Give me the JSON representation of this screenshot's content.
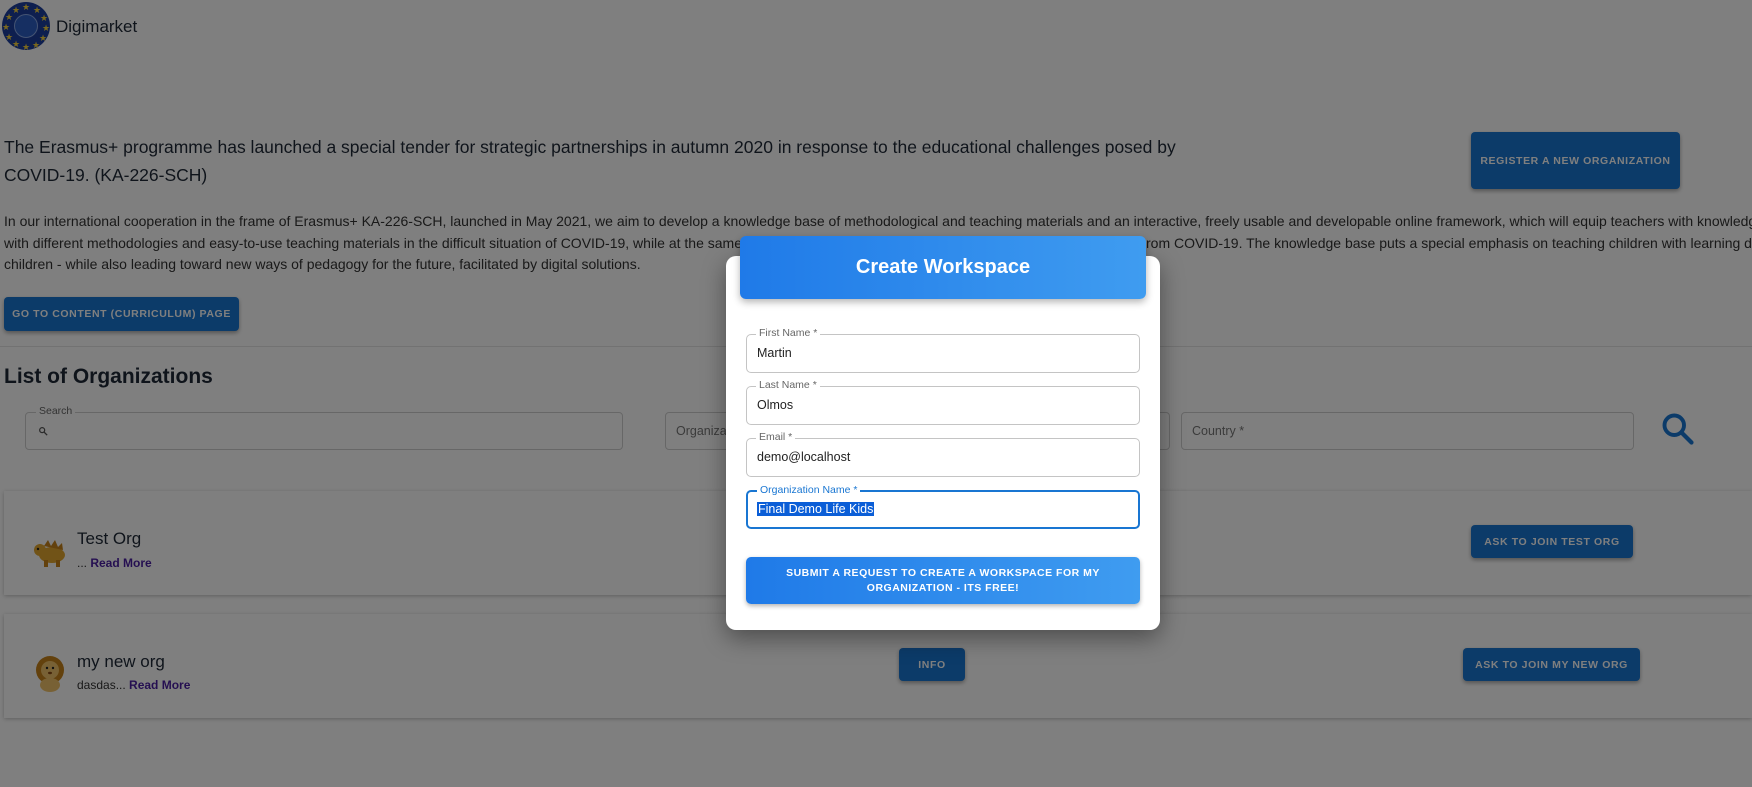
{
  "header": {
    "brand": "Digimarket"
  },
  "intro": {
    "headline": "The Erasmus+ programme has launched a special tender for strategic partnerships in autumn 2020 in response to the educational challenges posed by COVID-19. (KA-226-SCH)",
    "paragraph_line1": "In our international cooperation in the frame of Erasmus+ KA-226-SCH, launched in May 2021, we aim to develop a knowledge base of methodological and teaching materials and an interactive, freely usable and developable online framework, which will equip teachers with knowledge",
    "paragraph_line2_left": "with different methodologies and easy-to-use teaching materials in the difficult situation of COVID-19, while at the same",
    "paragraph_line2_right": "rom COVID-19. The knowledge base puts a special emphasis on teaching children with learning dif",
    "paragraph_line3": "children - while also leading toward new ways of pedagogy for the future, facilitated by digital solutions.",
    "register_button": "Register a new organization",
    "content_button": "Go to content (curriculum) page"
  },
  "list": {
    "title": "List of Organizations",
    "search_label": "Search",
    "org_placeholder": "Organiza",
    "country_placeholder": "Country *"
  },
  "orgs": [
    {
      "name": "Test Org",
      "desc_prefix": "... ",
      "read_more": "Read More",
      "join_button": "Ask to join Test Org"
    },
    {
      "name": "my new org",
      "desc_prefix": "dasdas... ",
      "read_more": "Read More",
      "info_button": "Info",
      "join_button": "Ask to join my new org"
    }
  ],
  "modal": {
    "title": "Create Workspace",
    "fields": [
      {
        "label": "First Name *",
        "value": "Martin"
      },
      {
        "label": "Last Name *",
        "value": "Olmos"
      },
      {
        "label": "Email *",
        "value": "demo@localhost"
      },
      {
        "label": "Organization Name *",
        "value": "Final Demo Life Kids"
      }
    ],
    "submit": "Submit a request to create a workspace for my organization - its free!"
  },
  "colors": {
    "primary": "#1976d2",
    "overlay": "rgba(0,0,0,0.5)",
    "read_more": "#4a1fa3"
  }
}
